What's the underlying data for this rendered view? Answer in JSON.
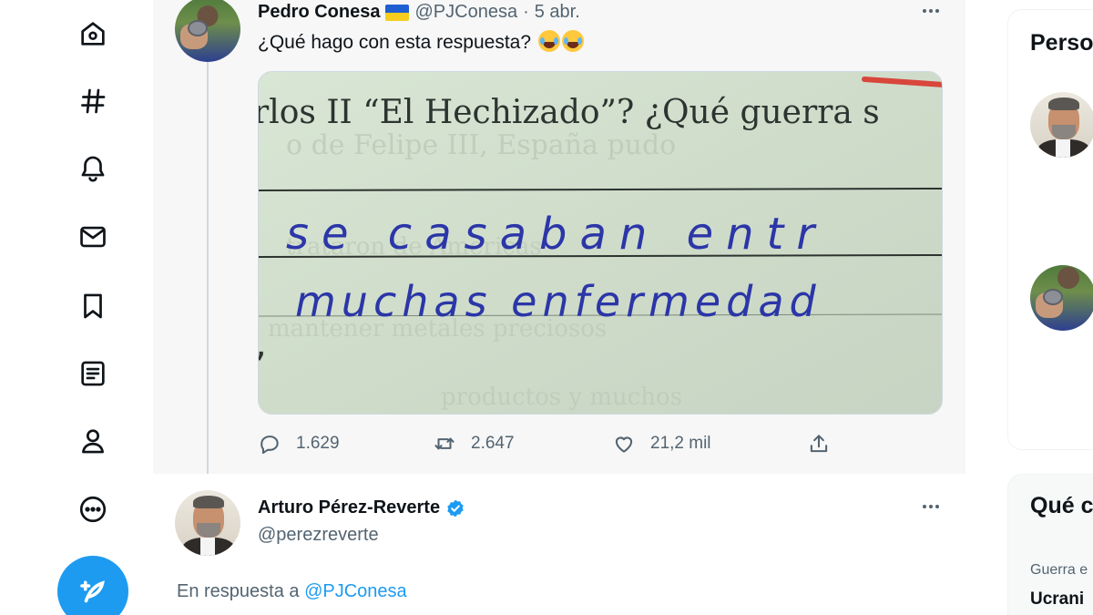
{
  "nav": {
    "items": [
      {
        "name": "home",
        "icon": "home-icon"
      },
      {
        "name": "explore",
        "icon": "hashtag-icon"
      },
      {
        "name": "notifications",
        "icon": "bell-icon"
      },
      {
        "name": "messages",
        "icon": "envelope-icon"
      },
      {
        "name": "bookmarks",
        "icon": "bookmark-icon"
      },
      {
        "name": "lists",
        "icon": "list-icon"
      },
      {
        "name": "profile",
        "icon": "person-icon"
      },
      {
        "name": "more",
        "icon": "more-circle-icon"
      }
    ],
    "compose_icon": "compose-feather-icon"
  },
  "tweet1": {
    "author_name": "Pedro Conesa",
    "handle": "@PJConesa",
    "separator": "·",
    "date": "5 abr.",
    "text": "¿Qué hago con esta respuesta?",
    "emoji": "tears-of-joy-emoji",
    "image": {
      "printed_line": "rlos II “El Hechizado”? ¿Qué guerra s",
      "handwritten_line1": "se casaban entr",
      "handwritten_line2": "muchas enfermedad"
    },
    "stats": {
      "replies": "1.629",
      "retweets": "2.647",
      "likes": "21,2 mil"
    }
  },
  "tweet2": {
    "author_name": "Arturo Pérez-Reverte",
    "handle": "@perezreverte",
    "reply_prefix": "En respuesta a",
    "reply_to": "@PJConesa"
  },
  "sidebar": {
    "who_to_follow_title": "Perso",
    "trends_title": "Qué c",
    "trend_category": "Guerra e",
    "trend_name": "Ucrani"
  },
  "colors": {
    "accent": "#1d9bf0",
    "text_primary": "#0f1419",
    "text_secondary": "#536471",
    "timeline_bg": "#f7f7f7"
  }
}
